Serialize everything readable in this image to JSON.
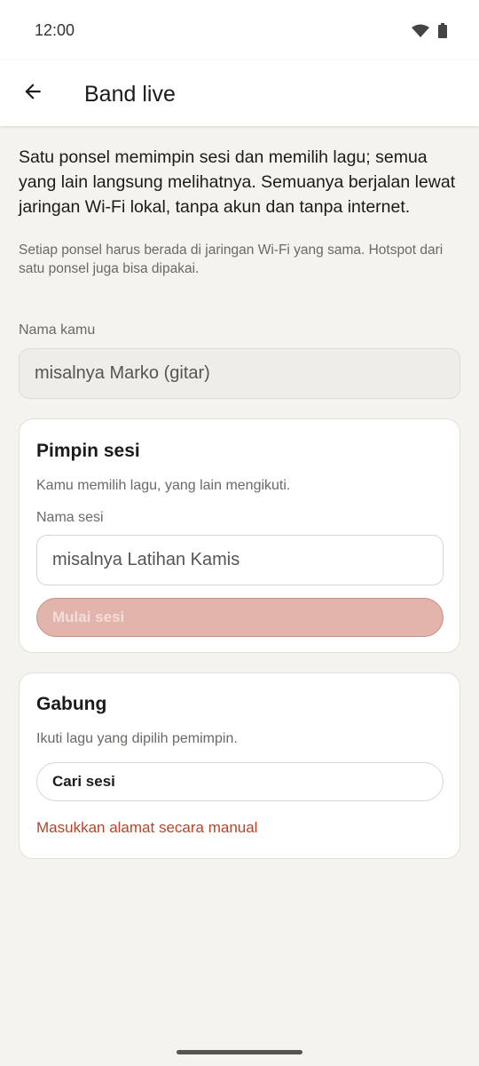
{
  "status_bar": {
    "time": "12:00",
    "icons": [
      "wifi-icon",
      "battery-icon"
    ]
  },
  "top_bar": {
    "back_icon": "arrow-left-icon",
    "title": "Band live"
  },
  "intro": {
    "text": "Satu ponsel memimpin sesi dan memilih lagu; semua yang lain langsung melihatnya. Semuanya berjalan lewat jaringan Wi-Fi lokal, tanpa akun dan tanpa internet.",
    "note": "Setiap ponsel harus berada di jaringan Wi-Fi yang sama. Hotspot dari satu ponsel juga bisa dipakai."
  },
  "name_field": {
    "label": "Nama kamu",
    "placeholder": "misalnya Marko (gitar)",
    "value": ""
  },
  "lead_card": {
    "title": "Pimpin sesi",
    "description": "Kamu memilih lagu, yang lain mengikuti.",
    "session_label": "Nama sesi",
    "session_placeholder": "misalnya Latihan Kamis",
    "start_button": "Mulai sesi",
    "start_enabled": false
  },
  "join_card": {
    "title": "Gabung",
    "description": "Ikuti lagu yang dipilih pemimpin.",
    "search_button": "Cari sesi",
    "manual_link": "Masukkan alamat secara manual"
  },
  "colors": {
    "accent": "#b5452a",
    "background": "#f5f3ee",
    "disabled_button": "#e2b4ac"
  }
}
